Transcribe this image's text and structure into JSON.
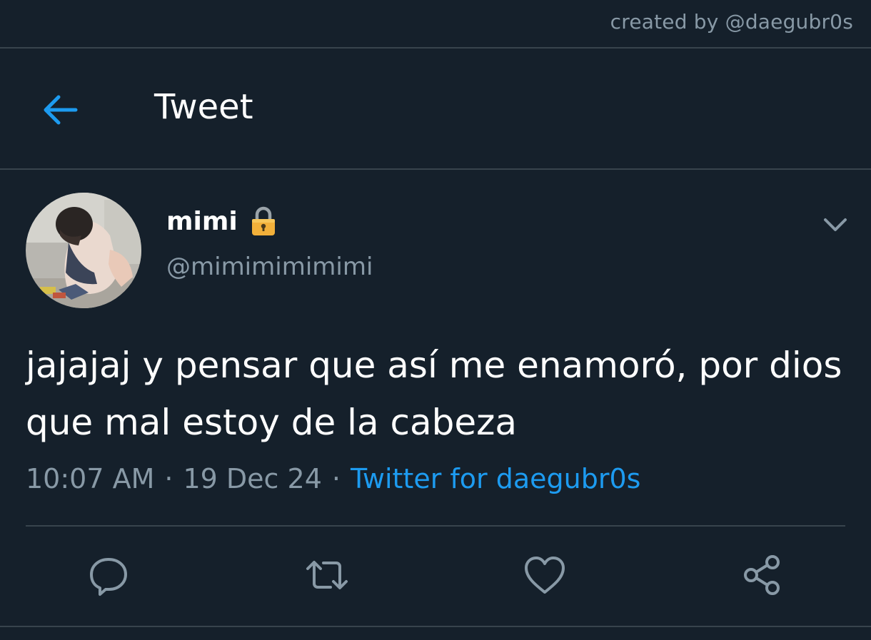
{
  "watermark": {
    "credit": "created by @daegubr0s"
  },
  "header": {
    "title": "Tweet",
    "back_icon": "arrow-left-icon"
  },
  "tweet": {
    "author": {
      "display_name": "mimi",
      "handle": "@mimimimimimi",
      "protected_icon": "lock-icon"
    },
    "text": "jajajaj y pensar que así me enamoró, por dios que mal estoy de la cabeza",
    "time": "10:07 AM",
    "separator": "·",
    "date": "19 Dec 24",
    "source": "Twitter for daegubr0s"
  },
  "actions": [
    {
      "name": "reply",
      "icon": "reply-icon"
    },
    {
      "name": "retweet",
      "icon": "retweet-icon"
    },
    {
      "name": "like",
      "icon": "heart-icon"
    },
    {
      "name": "share",
      "icon": "share-icon"
    }
  ],
  "colors": {
    "background": "#15202b",
    "accent": "#1d9bf0",
    "secondary_text": "#8899a6",
    "divider": "#38444d",
    "lock": "#f2b03a"
  }
}
